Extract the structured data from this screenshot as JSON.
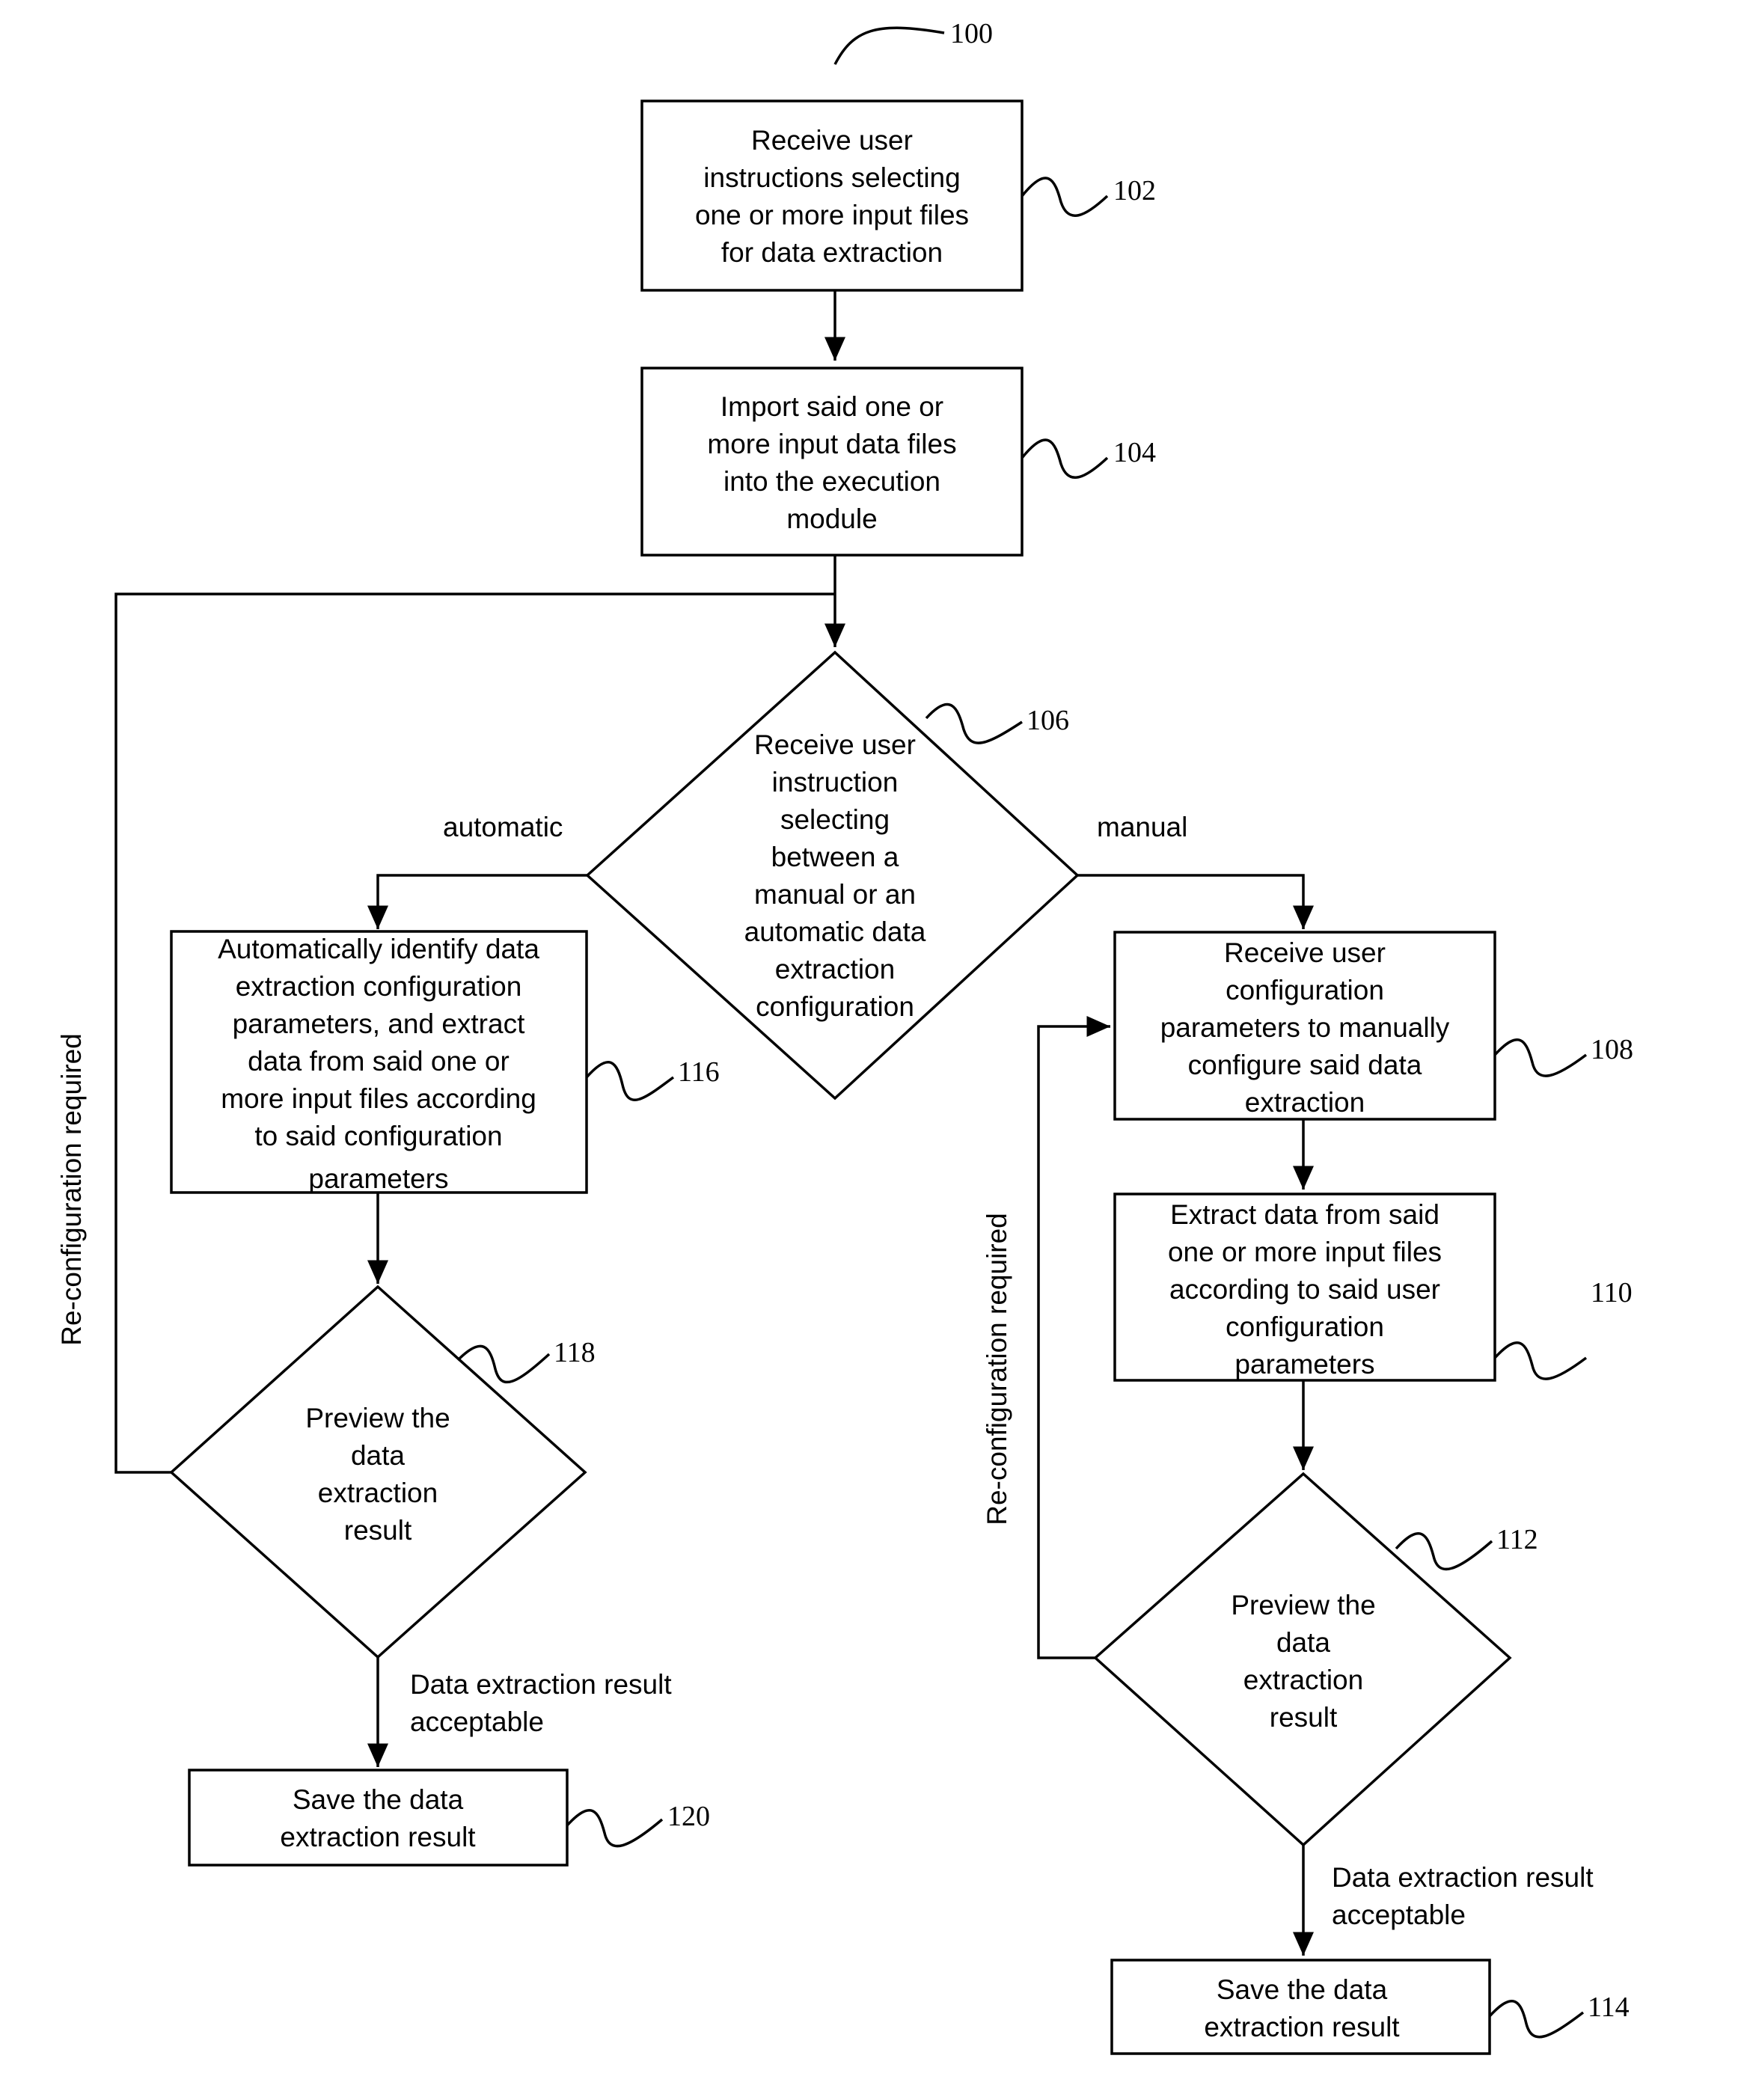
{
  "figure": {
    "ref": "100",
    "nodes": {
      "n102": {
        "ref": "102",
        "type": "process",
        "lines": [
          "Receive user",
          "instructions selecting",
          "one or more input files",
          "for data extraction"
        ]
      },
      "n104": {
        "ref": "104",
        "type": "process",
        "lines": [
          "Import said one or",
          "more input data files",
          "into the execution",
          "module"
        ]
      },
      "n106": {
        "ref": "106",
        "type": "decision",
        "lines": [
          "Receive user",
          "instruction",
          "selecting",
          "between a",
          "manual or an",
          "automatic data",
          "extraction",
          "configuration"
        ]
      },
      "n116": {
        "ref": "116",
        "type": "process",
        "lines": [
          "Automatically identify data",
          "extraction configuration",
          "parameters, and extract",
          "data from said one or",
          "more input files according",
          "to said configuration",
          "parameters"
        ]
      },
      "n118": {
        "ref": "118",
        "type": "decision",
        "lines": [
          "Preview the",
          "data",
          "extraction",
          "result"
        ]
      },
      "n120": {
        "ref": "120",
        "type": "process",
        "lines": [
          "Save the data",
          "extraction result"
        ]
      },
      "n108": {
        "ref": "108",
        "type": "process",
        "lines": [
          "Receive user",
          "configuration",
          "parameters to manually",
          "configure said data",
          "extraction"
        ]
      },
      "n110": {
        "ref": "110",
        "type": "process",
        "lines": [
          "Extract data from said",
          "one or more input files",
          "according to said user",
          "configuration",
          "parameters"
        ]
      },
      "n112": {
        "ref": "112",
        "type": "decision",
        "lines": [
          "Preview the",
          "data",
          "extraction",
          "result"
        ]
      },
      "n114": {
        "ref": "114",
        "type": "process",
        "lines": [
          "Save the data",
          "extraction result"
        ]
      }
    },
    "edge_labels": {
      "automatic": "automatic",
      "manual": "manual",
      "reconfig_left": "Re-configuration required",
      "reconfig_right": "Re-configuration required",
      "accept_left": [
        "Data extraction result",
        "acceptable"
      ],
      "accept_right": [
        "Data extraction result",
        "acceptable"
      ]
    }
  }
}
